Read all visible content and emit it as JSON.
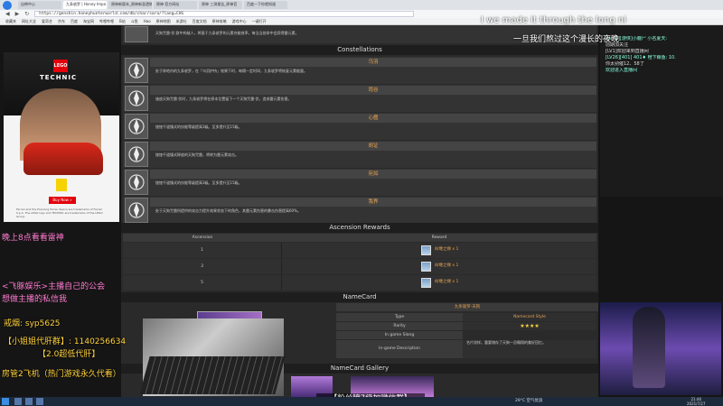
{
  "browser": {
    "tabs": [
      "自带中心",
      "九条裟罗 | Honey Impa",
      "原神新版本_原神新圣遗物",
      "原神·官方网站",
      "原神 三测报告_原神官",
      "百度一下你就知道"
    ],
    "url": "https://genshin.honeyhunterworld.com/db/char/sara/?lang=CHS",
    "bookmarks": [
      "收藏夹",
      "网址大全",
      "爱奇艺",
      "京东",
      "百度",
      "淘宝网",
      "哔哩哔哩",
      "B站",
      "斗鱼",
      "Hao",
      "原神地图",
      "米游社",
      "百度文档",
      "原神攻略",
      "游戏中心",
      "一键打开"
    ]
  },
  "ad": {
    "brand": "LEGO",
    "product": "TECHNIC",
    "cta": "Buy Now »",
    "fine_print": "Ferrari and the Prancing Horse device are trademarks of Ferrari S.p.A. The LEGO logo and TECHNIC are trademarks of the LEGO Group."
  },
  "content": {
    "top_desc": "天狗咒雷·伏:群中的敌人，将基于九条裟罗的元素充能效率，每当当前命中会获得雷元素，",
    "constellations_title": "Constellations",
    "constellations": [
      {
        "name": "乌羽",
        "desc": "处于阵地内的九条裟罗，在「乌羽护持」效果下时，每隔一定时间，九条裟罗将恢复元素能量。"
      },
      {
        "name": "雨谷",
        "desc": "施放天狗咒雷·伏时，九条裟罗将在原本位置留下一个天狗咒雷·伏，造成雷元素伤害。"
      },
      {
        "name": "心艦",
        "desc": "煌煌千道镇式的技能等级提高3级。至多提升至15级。"
      },
      {
        "name": "胡证",
        "desc": "煌煌千道镇式释放的天狗咒雷，将转为雷元素攻击。"
      },
      {
        "name": "宛如",
        "desc": "煌煌千道镇式的技能等级提高3级。至多提升至15级。"
      },
      {
        "name": "我界",
        "desc": "处于天狗咒雷所提供的攻击力提升效果状态下的角色，其雷元素伤害的暴击伤害提高60%。"
      }
    ],
    "ascension_title": "Ascension Rewards",
    "ascension_headers": {
      "level": "Ascension",
      "reward": "Reward"
    },
    "ascension_rows": [
      {
        "level": "1",
        "reward": "纠缠之缘 x 1"
      },
      {
        "level": "3",
        "reward": "纠缠之缘 x 1"
      },
      {
        "level": "5",
        "reward": "纠缠之缘 x 1"
      }
    ],
    "namecard_title": "NameCard",
    "namecard_name": "九条裟罗·天狗",
    "namecard_info": [
      {
        "key": "Type",
        "value": "Namecard Style"
      },
      {
        "key": "Rarity",
        "value": "★★★★"
      },
      {
        "key": "In game Slang",
        "value": ""
      },
      {
        "key": "In-game Description",
        "value": "名片纹样。重要储存了天狗一员翱翔的美好回忆。"
      }
    ],
    "gallery_title": "NameCard Gallery"
  },
  "chat": {
    "lines": [
      "[LV44][游侠]小鹿尸 小名夏天:",
      "前期加关注",
      "[LV1]欢迎来到直播间",
      "[LV26][401] 401♦ 橙下鲸鱼: 10.",
      "你太别催12、58了",
      "欢迎进入直播间"
    ]
  },
  "stream_overlay": {
    "top_en": "I we made it through the long ni",
    "top_cn": "一旦我们熬过这个漫长的夜晚",
    "left_1": "晚上8点看看雷神",
    "left_2": "<飞豚娱乐>主播自己的公会",
    "left_3": "想做主播的私信我",
    "left_4": "戒烟: syp5625",
    "left_5": "【小姐姐代肝群】: 1140256634",
    "left_6": "【2.0超低代肝】",
    "left_7": "房管2飞机（热门游戏永久代看）",
    "subtitle": "【粉丝牌7级加微信群】"
  },
  "taskbar": {
    "weather": "29°C 空气优良",
    "time": "21:46",
    "date": "2021/7/27"
  },
  "colors": {
    "accent_orange": "#e8a34f",
    "overlay_pink": "#ff7ad0",
    "overlay_yellow": "#ffd23a",
    "panel_dark": "#2a2a2a"
  }
}
